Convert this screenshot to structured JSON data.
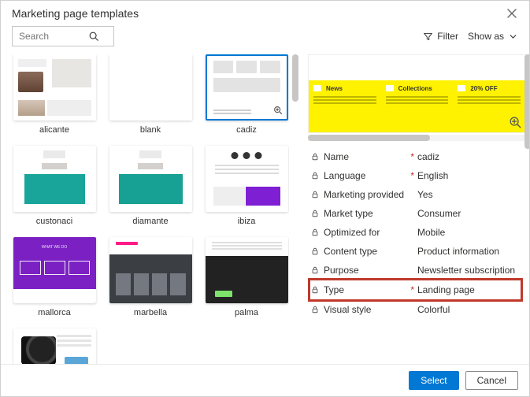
{
  "dialog": {
    "title": "Marketing page templates"
  },
  "toolbar": {
    "search_placeholder": "Search",
    "filter_label": "Filter",
    "showas_label": "Show as"
  },
  "gallery": {
    "items": [
      {
        "name": "alicante"
      },
      {
        "name": "blank"
      },
      {
        "name": "cadiz"
      },
      {
        "name": "custonaci"
      },
      {
        "name": "diamante"
      },
      {
        "name": "ibiza"
      },
      {
        "name": "mallorca"
      },
      {
        "name": "marbella"
      },
      {
        "name": "palma"
      },
      {
        "name": ""
      }
    ],
    "selected_index": 2
  },
  "preview": {
    "cols": [
      {
        "label": "News"
      },
      {
        "label": "Collections"
      },
      {
        "label": "20% OFF"
      }
    ]
  },
  "props": [
    {
      "label": "Name",
      "value": "cadiz",
      "required": true,
      "highlight": false
    },
    {
      "label": "Language",
      "value": "English",
      "required": true,
      "highlight": false
    },
    {
      "label": "Marketing provided",
      "value": "Yes",
      "required": false,
      "highlight": false
    },
    {
      "label": "Market type",
      "value": "Consumer",
      "required": false,
      "highlight": false
    },
    {
      "label": "Optimized for",
      "value": "Mobile",
      "required": false,
      "highlight": false
    },
    {
      "label": "Content type",
      "value": "Product information",
      "required": false,
      "highlight": false
    },
    {
      "label": "Purpose",
      "value": "Newsletter subscription",
      "required": false,
      "highlight": false
    },
    {
      "label": "Type",
      "value": "Landing page",
      "required": true,
      "highlight": true
    },
    {
      "label": "Visual style",
      "value": "Colorful",
      "required": false,
      "highlight": false
    }
  ],
  "footer": {
    "select_label": "Select",
    "cancel_label": "Cancel"
  }
}
